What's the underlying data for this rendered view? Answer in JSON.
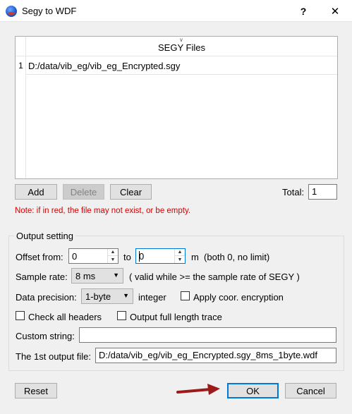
{
  "window": {
    "title": "Segy to WDF",
    "help": "?",
    "close": "✕"
  },
  "table": {
    "header": "SEGY Files",
    "rows": [
      {
        "num": "1",
        "path": "D:/data/vib_eg/vib_eg_Encrypted.sgy"
      }
    ]
  },
  "buttons": {
    "add": "Add",
    "delete": "Delete",
    "clear": "Clear",
    "reset": "Reset",
    "ok": "OK",
    "cancel": "Cancel"
  },
  "total": {
    "label": "Total:",
    "value": "1"
  },
  "note": "Note: if in red, the file may not exist, or be empty.",
  "output": {
    "group_label": "Output setting",
    "offset_from_label": "Offset from:",
    "offset_from_value": "0",
    "to_label": "to",
    "offset_to_value": "0",
    "offset_unit": "m  (both 0, no limit)",
    "sample_rate_label": "Sample rate:",
    "sample_rate_value": "8 ms",
    "sample_rate_note": "( valid while >= the sample rate of SEGY )",
    "precision_label": "Data precision:",
    "precision_value": "1-byte",
    "precision_type": "integer",
    "coor_encryption_label": "Apply coor. encryption",
    "check_headers_label": "Check all headers",
    "full_length_label": "Output full length trace",
    "custom_string_label": "Custom string:",
    "custom_string_value": "",
    "first_output_label": "The 1st output file:",
    "first_output_value": "D:/data/vib_eg/vib_eg_Encrypted.sgy_8ms_1byte.wdf"
  },
  "colors": {
    "accent": "#0078d7",
    "note": "#d40000",
    "arrow": "#9b1b1b"
  }
}
